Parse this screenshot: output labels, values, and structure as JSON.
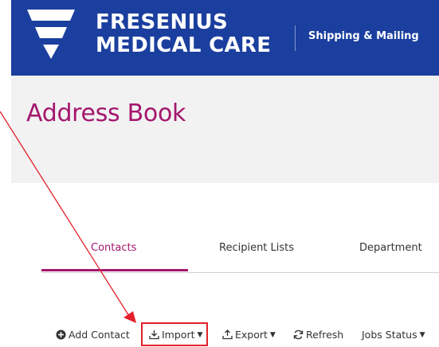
{
  "header": {
    "brand_line1": "FRESENIUS",
    "brand_line2": "MEDICAL CARE",
    "section": "Shipping & Mailing",
    "background_color": "#1b3f9e"
  },
  "page": {
    "title": "Address Book",
    "title_color": "#a4166d"
  },
  "tabs": [
    {
      "label": "Contacts",
      "active": true
    },
    {
      "label": "Recipient Lists",
      "active": false
    },
    {
      "label": "Department",
      "active": false
    }
  ],
  "toolbar": {
    "add_contact": "Add Contact",
    "import": "Import",
    "export": "Export",
    "refresh": "Refresh",
    "jobs_status": "Jobs Status",
    "icons": [
      "plus-circle-icon",
      "download-icon",
      "upload-icon",
      "refresh-icon",
      "caret-down-icon"
    ]
  },
  "annotation": {
    "color": "#e3202a",
    "target": "import-button"
  }
}
